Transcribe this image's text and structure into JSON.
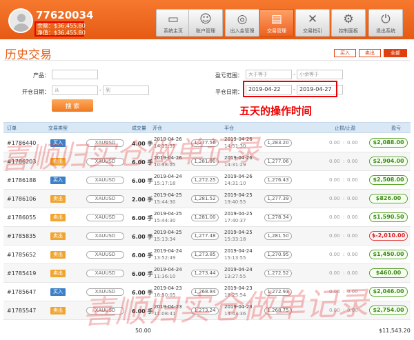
{
  "header": {
    "user_id": "77620034",
    "balance_label": "余额：",
    "balance_value": "$36,455.80",
    "equity_label": "净值：",
    "equity_value": "$36,455.80"
  },
  "nav": {
    "items": [
      {
        "label": "系统主页",
        "icon": "monitor-icon",
        "active": false
      },
      {
        "label": "账户管理",
        "icon": "user-icon",
        "active": false
      },
      {
        "label": "出入金管理",
        "icon": "compass-icon",
        "active": false
      },
      {
        "label": "交易管理",
        "icon": "chart-icon",
        "active": true
      },
      {
        "label": "交易指引",
        "icon": "tools-icon",
        "active": false
      },
      {
        "label": "控制面板",
        "icon": "gear-icon",
        "active": false
      },
      {
        "label": "退出系统",
        "icon": "power-icon",
        "active": false
      }
    ]
  },
  "page": {
    "title": "历史交易",
    "filter_tabs": {
      "buy": "买入",
      "sell": "卖出",
      "all": "全部"
    }
  },
  "filters": {
    "product_label": "产品：",
    "product_value": "",
    "open_date_label": "开仓日期：",
    "open_from_placeholder": "从",
    "open_to_placeholder": "到",
    "profit_range_label": "盈亏范围：",
    "profit_min_placeholder": "大于等于",
    "profit_max_placeholder": "小余等于",
    "close_date_label": "平仓日期：",
    "close_from": "2019-04-22",
    "close_to": "2019-04-27",
    "dash": "-",
    "search_label": "搜 索",
    "annotation": "五天的操作时间"
  },
  "table": {
    "headers": {
      "order": "订单",
      "type": "交易类型",
      "lots": "成交量",
      "open": "开仓",
      "close": "平仓",
      "sltp": "止损/止盈",
      "profit": "盈亏"
    },
    "rows": [
      {
        "order": "#1786440",
        "type": "买入",
        "side": "buy",
        "symbol": "XAUUSD",
        "lots": "4.00 手",
        "open_date": "2019-04-26",
        "open_time": "14:12:35",
        "open_price": "1,277.56",
        "close_date": "2019-04-26",
        "close_time": "14:51:30",
        "close_price": "1,283.20",
        "sl": "0.00",
        "tp": "0.00",
        "profit": "$2,088.00",
        "profit_sign": "pos"
      },
      {
        "order": "#1786203",
        "type": "卖出",
        "side": "sell",
        "symbol": "XAUUSD",
        "lots": "6.00 手",
        "open_date": "2019-04-26",
        "open_time": "10:38:05",
        "open_price": "1,281.90",
        "close_date": "2019-04-26",
        "close_time": "14:31:29",
        "close_price": "1,277.06",
        "sl": "0.00",
        "tp": "0.00",
        "profit": "$2,904.00",
        "profit_sign": "pos"
      },
      {
        "order": "#1786188",
        "type": "买入",
        "side": "buy",
        "symbol": "XAUUSD",
        "lots": "6.00 手",
        "open_date": "2019-04-24",
        "open_time": "15:17:18",
        "open_price": "1,272.25",
        "close_date": "2019-04-26",
        "close_time": "14:31:10",
        "close_price": "1,276.43",
        "sl": "0.00",
        "tp": "0.00",
        "profit": "$2,508.00",
        "profit_sign": "pos"
      },
      {
        "order": "#1786106",
        "type": "卖出",
        "side": "sell",
        "symbol": "XAUUSD",
        "lots": "2.00 手",
        "open_date": "2019-04-25",
        "open_time": "15:44:30",
        "open_price": "1,281.52",
        "close_date": "2019-04-25",
        "close_time": "19:40:55",
        "close_price": "1,277.39",
        "sl": "0.00",
        "tp": "0.00",
        "profit": "$826.00",
        "profit_sign": "pos"
      },
      {
        "order": "#1786055",
        "type": "卖出",
        "side": "sell",
        "symbol": "XAUUSD",
        "lots": "6.00 手",
        "open_date": "2019-04-25",
        "open_time": "15:44:30",
        "open_price": "1,281.00",
        "close_date": "2019-04-25",
        "close_time": "17:40:37",
        "close_price": "1,278.34",
        "sl": "0.00",
        "tp": "0.00",
        "profit": "$1,590.50",
        "profit_sign": "pos"
      },
      {
        "order": "#1785835",
        "type": "卖出",
        "side": "sell",
        "symbol": "XAUUSD",
        "lots": "6.00 手",
        "open_date": "2019-04-25",
        "open_time": "15:13:34",
        "open_price": "1,277.48",
        "close_date": "2019-04-25",
        "close_time": "15:33:18",
        "close_price": "1,281.50",
        "sl": "0.00",
        "tp": "0.00",
        "profit": "$-2,010.00",
        "profit_sign": "neg"
      },
      {
        "order": "#1785652",
        "type": "卖出",
        "side": "sell",
        "symbol": "XAUUSD",
        "lots": "6.00 手",
        "open_date": "2019-04-24",
        "open_time": "13:52:49",
        "open_price": "1,273.85",
        "close_date": "2019-04-24",
        "close_time": "15:13:55",
        "close_price": "1,270.95",
        "sl": "0.00",
        "tp": "0.00",
        "profit": "$1,450.00",
        "profit_sign": "pos"
      },
      {
        "order": "#1785419",
        "type": "卖出",
        "side": "sell",
        "symbol": "XAUUSD",
        "lots": "6.00 手",
        "open_date": "2019-04-24",
        "open_time": "11:36:10",
        "open_price": "1,273.44",
        "close_date": "2019-04-24",
        "close_time": "13:27:55",
        "close_price": "1,272.52",
        "sl": "0.00",
        "tp": "0.00",
        "profit": "$460.00",
        "profit_sign": "pos"
      },
      {
        "order": "#1785647",
        "type": "买入",
        "side": "buy",
        "symbol": "XAUUSD",
        "lots": "6.00 手",
        "open_date": "2019-04-23",
        "open_time": "16:50:05",
        "open_price": "1,268.84",
        "close_date": "2019-04-23",
        "close_time": "18:25:54",
        "close_price": "1,272.93",
        "sl": "0.00",
        "tp": "0.00",
        "profit": "$2,046.00",
        "profit_sign": "pos"
      },
      {
        "order": "#1785547",
        "type": "卖出",
        "side": "sell",
        "symbol": "XAUUSD",
        "lots": "6.00 手",
        "open_date": "2019-04-23",
        "open_time": "11:08:41",
        "open_price": "1,273.24",
        "close_date": "2019-04-23",
        "close_time": "14:43:36",
        "close_price": "1,268.75",
        "sl": "0.00",
        "tp": "0.00",
        "profit": "$2,754.00",
        "profit_sign": "pos"
      }
    ],
    "total_lots": "50.00",
    "total_profit": "$11,543.20"
  },
  "watermark": {
    "line1": "喜顺归实仓做单记录",
    "line2": "喜顺归实仓做单记录"
  }
}
